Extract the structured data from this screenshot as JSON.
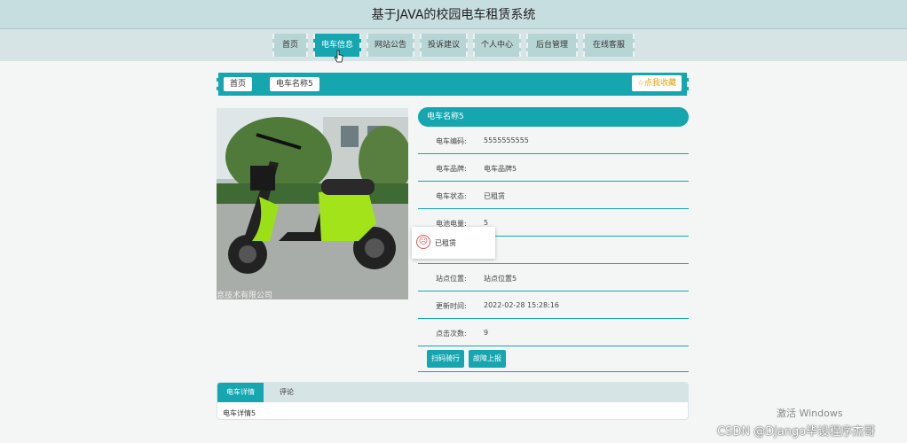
{
  "header": {
    "title": "基于JAVA的校园电车租赁系统"
  },
  "nav": [
    {
      "label": "首页",
      "active": false
    },
    {
      "label": "电车信息",
      "active": true
    },
    {
      "label": "网站公告",
      "active": false
    },
    {
      "label": "投诉建议",
      "active": false
    },
    {
      "label": "个人中心",
      "active": false
    },
    {
      "label": "后台管理",
      "active": false
    },
    {
      "label": "在线客服",
      "active": false
    }
  ],
  "breadcrumb": {
    "home": "首页",
    "current": "电车名称5",
    "favorite": "☆点我收藏"
  },
  "photo": {
    "watermark": "息技术有限公司"
  },
  "info": {
    "title": "电车名称5",
    "rows": [
      {
        "label": "电车编码:",
        "value": "5555555555"
      },
      {
        "label": "电车品牌:",
        "value": "电车品牌5"
      },
      {
        "label": "电车状态:",
        "value": "已租赁"
      },
      {
        "label": "电池电量:",
        "value": "5"
      },
      {
        "label": "",
        "value": ""
      },
      {
        "label": "站点位置:",
        "value": "站点位置5"
      },
      {
        "label": "更新时间:",
        "value": "2022-02-28 15:28:16"
      },
      {
        "label": "点击次数:",
        "value": "9"
      }
    ],
    "buttons": [
      "扫码骑行",
      "故障上报"
    ]
  },
  "popup": {
    "icon": "sad-face-icon",
    "text": "已租赁"
  },
  "tabs": {
    "items": [
      "电车详情",
      "评论"
    ],
    "content": "电车详情5"
  },
  "overlay": {
    "windows_line1": "激活 Windows",
    "csdn": "CSDN @Django毕设程序杰哥"
  },
  "colors": {
    "accent": "#16a6b0",
    "header_bg": "#c7dee0"
  }
}
